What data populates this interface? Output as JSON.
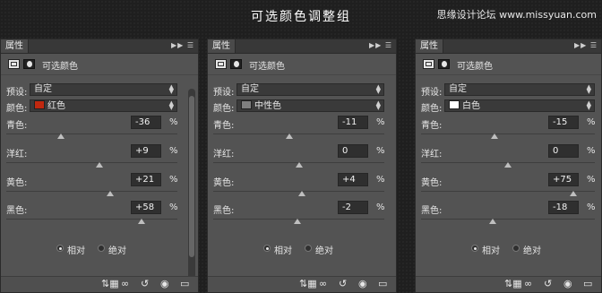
{
  "page": {
    "title": "可选颜色调整组",
    "watermark": "思缘设计论坛 www.missyuan.com"
  },
  "panels": [
    {
      "tab": "属性",
      "header": "可选颜色",
      "preset_label": "预设:",
      "preset": "自定",
      "color_label": "颜色:",
      "color_name": "红色",
      "color_swatch": "#c0280f",
      "sliders": [
        {
          "label": "青色:",
          "value": "-36",
          "unit": "%"
        },
        {
          "label": "洋红:",
          "value": "+9",
          "unit": "%"
        },
        {
          "label": "黄色:",
          "value": "+21",
          "unit": "%"
        },
        {
          "label": "黑色:",
          "value": "+58",
          "unit": "%"
        }
      ],
      "radio_relative": "相对",
      "radio_absolute": "绝对"
    },
    {
      "tab": "属性",
      "header": "可选颜色",
      "preset_label": "预设:",
      "preset": "自定",
      "color_label": "颜色:",
      "color_name": "中性色",
      "color_swatch": "#808080",
      "sliders": [
        {
          "label": "青色:",
          "value": "-11",
          "unit": "%"
        },
        {
          "label": "洋红:",
          "value": "0",
          "unit": "%"
        },
        {
          "label": "黄色:",
          "value": "+4",
          "unit": "%"
        },
        {
          "label": "黑色:",
          "value": "-2",
          "unit": "%"
        }
      ],
      "radio_relative": "相对",
      "radio_absolute": "绝对"
    },
    {
      "tab": "属性",
      "header": "可选颜色",
      "preset_label": "预设:",
      "preset": "自定",
      "color_label": "颜色:",
      "color_name": "白色",
      "color_swatch": "#ffffff",
      "sliders": [
        {
          "label": "青色:",
          "value": "-15",
          "unit": "%"
        },
        {
          "label": "洋红:",
          "value": "0",
          "unit": "%"
        },
        {
          "label": "黄色:",
          "value": "+75",
          "unit": "%"
        },
        {
          "label": "黑色:",
          "value": "-18",
          "unit": "%"
        }
      ],
      "radio_relative": "相对",
      "radio_absolute": "绝对"
    }
  ],
  "bottom_icons": [
    "clip-to-layer-icon",
    "view-previous-icon",
    "reset-icon",
    "visibility-icon",
    "delete-icon"
  ]
}
